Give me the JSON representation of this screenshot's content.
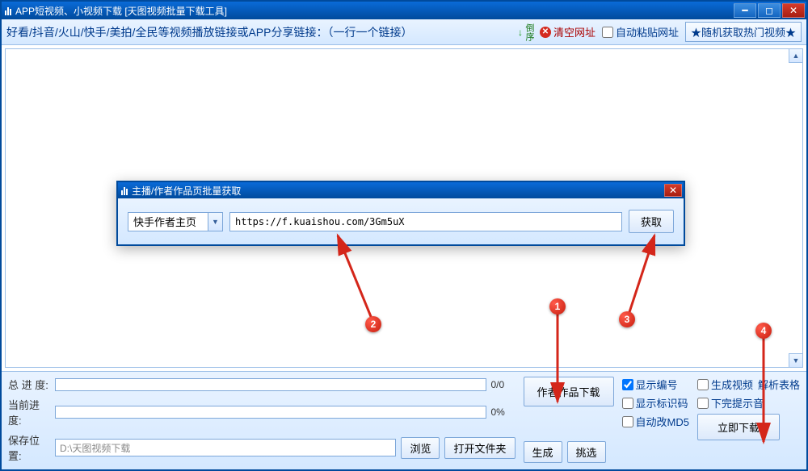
{
  "window": {
    "title": "APP短视频、小视频下载 [天图视频批量下载工具]"
  },
  "topbar": {
    "hint": "好看/抖音/火山/快手/美拍/全民等视频播放链接或APP分享链接：（一行一个链接）",
    "reverse": "倒序",
    "clear": "清空网址",
    "auto_paste": "自动粘贴网址",
    "random_hot": "★随机获取热门视频★"
  },
  "bottom": {
    "total_label": "总 进 度:",
    "total_count": "0/0",
    "current_label": "当前进度:",
    "current_pct": "0%",
    "save_label": "保存位置:",
    "save_path": "D:\\天图视频下载",
    "browse": "浏览",
    "open_folder": "打开文件夹",
    "author_works": "作者作品下载",
    "generate": "生成",
    "pick": "挑选",
    "show_id": "显示编号",
    "show_marker": "显示标识码",
    "auto_md5": "自动改MD5",
    "gen_video": "生成视频",
    "parse_table": "解析表格",
    "finish_sound": "下完提示音",
    "download_now": "立即下载"
  },
  "dialog": {
    "title": "主播/作者作品页批量获取",
    "combo_selected": "快手作者主页",
    "url": "https://f.kuaishou.com/3Gm5uX",
    "fetch": "获取"
  },
  "annotations": {
    "m1": "1",
    "m2": "2",
    "m3": "3",
    "m4": "4"
  }
}
